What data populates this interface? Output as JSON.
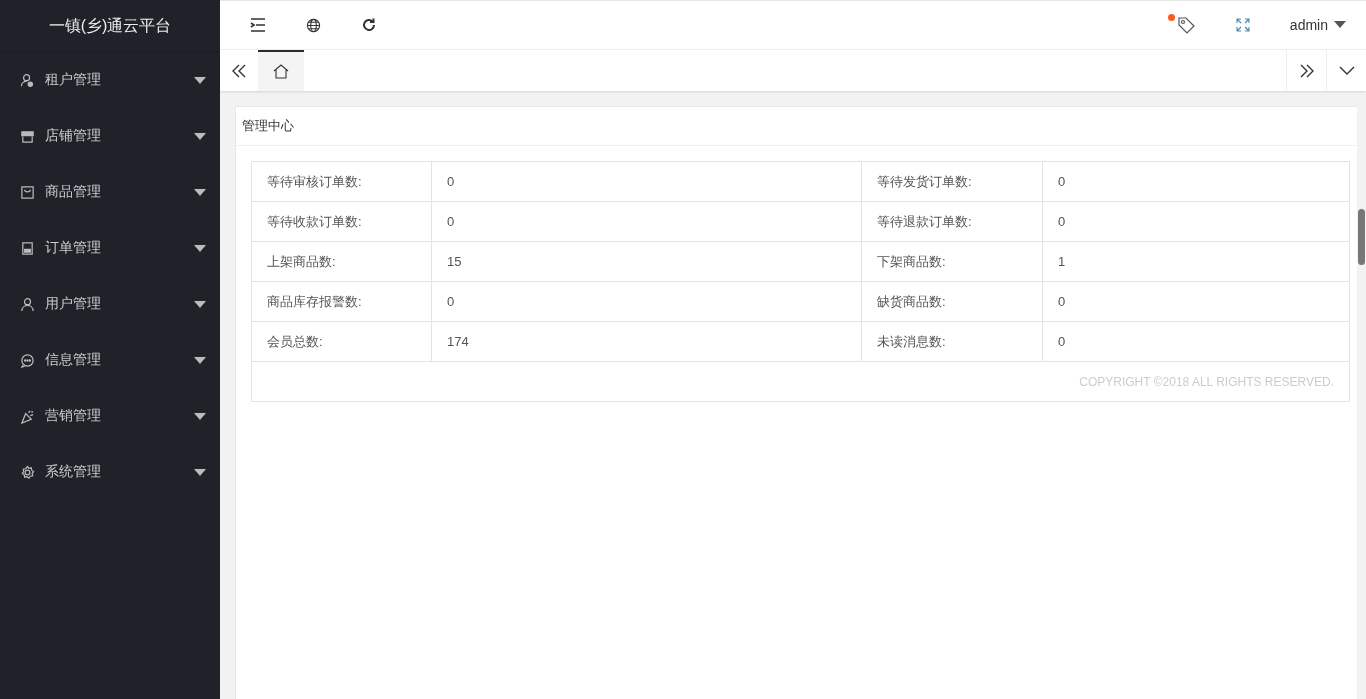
{
  "app": {
    "title": "一镇(乡)通云平台"
  },
  "sidebar": {
    "items": [
      {
        "label": "租户管理",
        "expanded": false
      },
      {
        "label": "店铺管理",
        "expanded": false
      },
      {
        "label": "商品管理",
        "expanded": false
      },
      {
        "label": "订单管理",
        "expanded": false
      },
      {
        "label": "用户管理",
        "expanded": false
      },
      {
        "label": "信息管理",
        "expanded": false
      },
      {
        "label": "营销管理",
        "expanded": false
      },
      {
        "label": "系统管理",
        "expanded": false
      }
    ]
  },
  "header": {
    "notification_unread": true,
    "user": "admin"
  },
  "tabs": [
    {
      "kind": "home",
      "selected": true
    }
  ],
  "panel": {
    "title": "管理中心",
    "rows": [
      [
        "等待审核订单数:",
        "0",
        "等待发货订单数:",
        "0"
      ],
      [
        "等待收款订单数:",
        "0",
        "等待退款订单数:",
        "0"
      ],
      [
        "上架商品数:",
        "15",
        "下架商品数:",
        "1"
      ],
      [
        "商品库存报警数:",
        "0",
        "缺货商品数:",
        "0"
      ],
      [
        "会员总数:",
        "174",
        "未读消息数:",
        "0"
      ]
    ],
    "footer": "COPYRIGHT ©2018 ALL RIGHTS RESERVED."
  }
}
